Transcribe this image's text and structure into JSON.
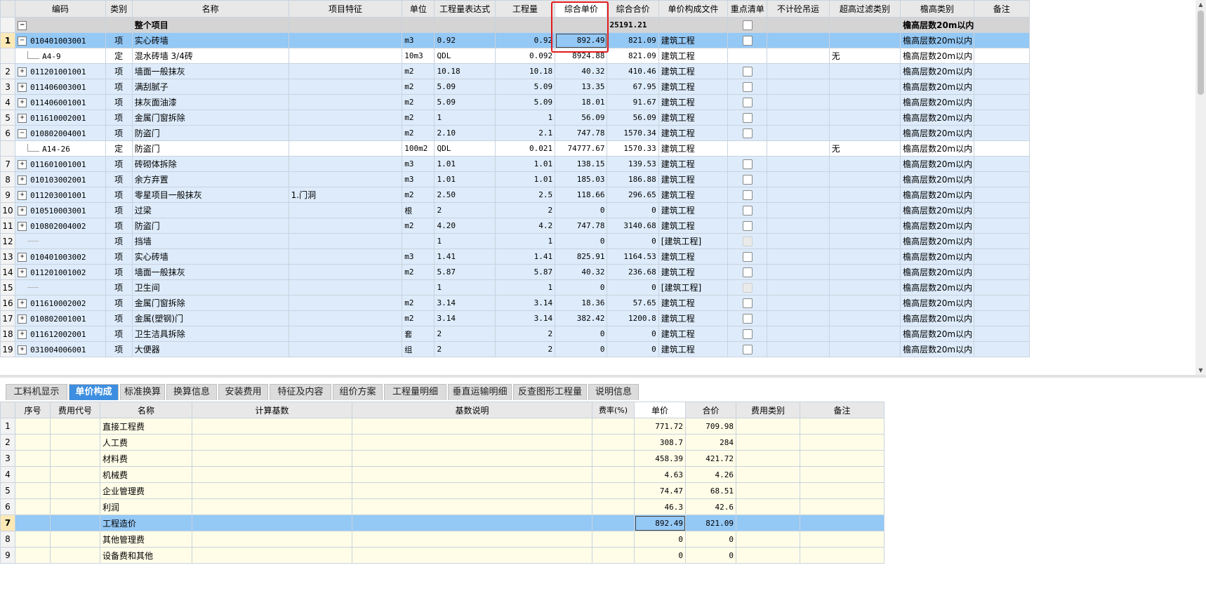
{
  "top_grid": {
    "headers": [
      "",
      "编码",
      "类别",
      "名称",
      "项目特征",
      "单位",
      "工程量表达式",
      "工程量",
      "综合单价",
      "综合合价",
      "单价构成文件",
      "重点清单",
      "不计砼吊运",
      "超高过滤类别",
      "檐高类别",
      "备注"
    ],
    "root_row": {
      "name": "整个项目",
      "total": "25191.21",
      "eave": "檐高层数20m以内"
    },
    "rows": [
      {
        "no": "1",
        "code": "010401003001",
        "type": "项",
        "name": "实心砖墙",
        "feature": "",
        "unit": "m3",
        "expr": "0.92",
        "qty": "0.92",
        "price": "892.49",
        "total": "821.09",
        "file": "建筑工程",
        "filter": "",
        "eave": "檐高层数20m以内"
      },
      {
        "no": "",
        "code": "A4-9",
        "type": "定",
        "name": "混水砖墙 3/4砖",
        "feature": "",
        "unit": "10m3",
        "expr": "QDL",
        "qty": "0.092",
        "price": "8924.88",
        "total": "821.09",
        "file": "建筑工程",
        "filter": "无",
        "eave": "檐高层数20m以内"
      },
      {
        "no": "2",
        "code": "011201001001",
        "type": "项",
        "name": "墙面一般抹灰",
        "feature": "",
        "unit": "m2",
        "expr": "10.18",
        "qty": "10.18",
        "price": "40.32",
        "total": "410.46",
        "file": "建筑工程",
        "filter": "",
        "eave": "檐高层数20m以内"
      },
      {
        "no": "3",
        "code": "011406003001",
        "type": "项",
        "name": "满刮腻子",
        "feature": "",
        "unit": "m2",
        "expr": "5.09",
        "qty": "5.09",
        "price": "13.35",
        "total": "67.95",
        "file": "建筑工程",
        "filter": "",
        "eave": "檐高层数20m以内"
      },
      {
        "no": "4",
        "code": "011406001001",
        "type": "项",
        "name": "抹灰面油漆",
        "feature": "",
        "unit": "m2",
        "expr": "5.09",
        "qty": "5.09",
        "price": "18.01",
        "total": "91.67",
        "file": "建筑工程",
        "filter": "",
        "eave": "檐高层数20m以内"
      },
      {
        "no": "5",
        "code": "011610002001",
        "type": "项",
        "name": "金属门窗拆除",
        "feature": "",
        "unit": "m2",
        "expr": "1",
        "qty": "1",
        "price": "56.09",
        "total": "56.09",
        "file": "建筑工程",
        "filter": "",
        "eave": "檐高层数20m以内"
      },
      {
        "no": "6",
        "code": "010802004001",
        "type": "项",
        "name": "防盗门",
        "feature": "",
        "unit": "m2",
        "expr": "2.10",
        "qty": "2.1",
        "price": "747.78",
        "total": "1570.34",
        "file": "建筑工程",
        "filter": "",
        "eave": "檐高层数20m以内"
      },
      {
        "no": "",
        "code": "A14-26",
        "type": "定",
        "name": "防盗门",
        "feature": "",
        "unit": "100m2",
        "expr": "QDL",
        "qty": "0.021",
        "price": "74777.67",
        "total": "1570.33",
        "file": "建筑工程",
        "filter": "无",
        "eave": "檐高层数20m以内"
      },
      {
        "no": "7",
        "code": "011601001001",
        "type": "项",
        "name": "砖砌体拆除",
        "feature": "",
        "unit": "m3",
        "expr": "1.01",
        "qty": "1.01",
        "price": "138.15",
        "total": "139.53",
        "file": "建筑工程",
        "filter": "",
        "eave": "檐高层数20m以内"
      },
      {
        "no": "8",
        "code": "010103002001",
        "type": "项",
        "name": "余方弃置",
        "feature": "",
        "unit": "m3",
        "expr": "1.01",
        "qty": "1.01",
        "price": "185.03",
        "total": "186.88",
        "file": "建筑工程",
        "filter": "",
        "eave": "檐高层数20m以内"
      },
      {
        "no": "9",
        "code": "011203001001",
        "type": "项",
        "name": "零星项目一般抹灰",
        "feature": "1.门洞",
        "unit": "m2",
        "expr": "2.50",
        "qty": "2.5",
        "price": "118.66",
        "total": "296.65",
        "file": "建筑工程",
        "filter": "",
        "eave": "檐高层数20m以内"
      },
      {
        "no": "10",
        "code": "010510003001",
        "type": "项",
        "name": "过梁",
        "feature": "",
        "unit": "根",
        "expr": "2",
        "qty": "2",
        "price": "0",
        "total": "0",
        "file": "建筑工程",
        "filter": "",
        "eave": "檐高层数20m以内"
      },
      {
        "no": "11",
        "code": "010802004002",
        "type": "项",
        "name": "防盗门",
        "feature": "",
        "unit": "m2",
        "expr": "4.20",
        "qty": "4.2",
        "price": "747.78",
        "total": "3140.68",
        "file": "建筑工程",
        "filter": "",
        "eave": "檐高层数20m以内"
      },
      {
        "no": "12",
        "code": "",
        "type": "项",
        "name": "挡墙",
        "feature": "",
        "unit": "",
        "expr": "1",
        "qty": "1",
        "price": "0",
        "total": "0",
        "file": "[建筑工程]",
        "filter": "",
        "eave": "檐高层数20m以内"
      },
      {
        "no": "13",
        "code": "010401003002",
        "type": "项",
        "name": "实心砖墙",
        "feature": "",
        "unit": "m3",
        "expr": "1.41",
        "qty": "1.41",
        "price": "825.91",
        "total": "1164.53",
        "file": "建筑工程",
        "filter": "",
        "eave": "檐高层数20m以内"
      },
      {
        "no": "14",
        "code": "011201001002",
        "type": "项",
        "name": "墙面一般抹灰",
        "feature": "",
        "unit": "m2",
        "expr": "5.87",
        "qty": "5.87",
        "price": "40.32",
        "total": "236.68",
        "file": "建筑工程",
        "filter": "",
        "eave": "檐高层数20m以内"
      },
      {
        "no": "15",
        "code": "",
        "type": "项",
        "name": "卫生间",
        "feature": "",
        "unit": "",
        "expr": "1",
        "qty": "1",
        "price": "0",
        "total": "0",
        "file": "[建筑工程]",
        "filter": "",
        "eave": "檐高层数20m以内"
      },
      {
        "no": "16",
        "code": "011610002002",
        "type": "项",
        "name": "金属门窗拆除",
        "feature": "",
        "unit": "m2",
        "expr": "3.14",
        "qty": "3.14",
        "price": "18.36",
        "total": "57.65",
        "file": "建筑工程",
        "filter": "",
        "eave": "檐高层数20m以内"
      },
      {
        "no": "17",
        "code": "010802001001",
        "type": "项",
        "name": "金属(塑钢)门",
        "feature": "",
        "unit": "m2",
        "expr": "3.14",
        "qty": "3.14",
        "price": "382.42",
        "total": "1200.8",
        "file": "建筑工程",
        "filter": "",
        "eave": "檐高层数20m以内"
      },
      {
        "no": "18",
        "code": "011612002001",
        "type": "项",
        "name": "卫生洁具拆除",
        "feature": "",
        "unit": "套",
        "expr": "2",
        "qty": "2",
        "price": "0",
        "total": "0",
        "file": "建筑工程",
        "filter": "",
        "eave": "檐高层数20m以内"
      },
      {
        "no": "19",
        "code": "031004006001",
        "type": "项",
        "name": "大便器",
        "feature": "",
        "unit": "组",
        "expr": "2",
        "qty": "2",
        "price": "0",
        "total": "0",
        "file": "建筑工程",
        "filter": "",
        "eave": "檐高层数20m以内"
      }
    ]
  },
  "tabs": [
    "工料机显示",
    "单价构成",
    "标准换算",
    "换算信息",
    "安装费用",
    "特征及内容",
    "组价方案",
    "工程量明细",
    "垂直运输明细",
    "反查图形工程量",
    "说明信息"
  ],
  "active_tab": "单价构成",
  "bottom_grid": {
    "headers": [
      "",
      "序号",
      "费用代号",
      "名称",
      "计算基数",
      "基数说明",
      "费率(%)",
      "单价",
      "合价",
      "费用类别",
      "备注"
    ],
    "rows": [
      {
        "n": "1",
        "name": "直接工程费",
        "price": "771.72",
        "total": "709.98"
      },
      {
        "n": "2",
        "name": "人工费",
        "price": "308.7",
        "total": "284"
      },
      {
        "n": "3",
        "name": "材料费",
        "price": "458.39",
        "total": "421.72"
      },
      {
        "n": "4",
        "name": "机械费",
        "price": "4.63",
        "total": "4.26"
      },
      {
        "n": "5",
        "name": "企业管理费",
        "price": "74.47",
        "total": "68.51"
      },
      {
        "n": "6",
        "name": "利润",
        "price": "46.3",
        "total": "42.6"
      },
      {
        "n": "7",
        "name": "工程造价",
        "price": "892.49",
        "total": "821.09"
      },
      {
        "n": "8",
        "name": "其他管理费",
        "price": "0",
        "total": "0"
      },
      {
        "n": "9",
        "name": "设备费和其他",
        "price": "0",
        "total": "0"
      }
    ]
  }
}
